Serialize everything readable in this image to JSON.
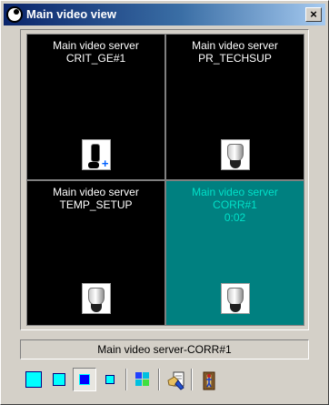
{
  "window": {
    "title": "Main video view",
    "close_glyph": "×",
    "app_icon": "camera-lens-icon"
  },
  "cells": [
    {
      "line1": "Main video server",
      "line2": "CRIT_GE#1",
      "line3": "",
      "camera_icon": "ptz-camera-icon",
      "active": false
    },
    {
      "line1": "Main video server",
      "line2": "PR_TECHSUP",
      "line3": "",
      "camera_icon": "dome-camera-icon",
      "active": false
    },
    {
      "line1": "Main video server",
      "line2": "TEMP_SETUP",
      "line3": "",
      "camera_icon": "dome-camera-icon",
      "active": false
    },
    {
      "line1": "Main video server",
      "line2": "CORR#1",
      "line3": "0:02",
      "camera_icon": "dome-camera-icon",
      "active": true
    }
  ],
  "status": {
    "text": "Main video server-CORR#1"
  },
  "toolbar": {
    "buttons": [
      {
        "name": "layout-1x1-button",
        "icon": "cyan-square-icon",
        "pressed": false
      },
      {
        "name": "layout-2x2-button",
        "icon": "cyan-square-icon",
        "pressed": false
      },
      {
        "name": "layout-3x3-button",
        "icon": "blue-square-icon",
        "pressed": true
      },
      {
        "name": "layout-4x4-button",
        "icon": "cyan-square-icon",
        "pressed": false
      },
      {
        "name": "layout-quad-button",
        "icon": "multicolor-grid-icon",
        "pressed": false
      },
      {
        "name": "properties-button",
        "icon": "hand-document-icon",
        "pressed": false
      },
      {
        "name": "exit-button",
        "icon": "door-exit-icon",
        "pressed": false
      }
    ]
  },
  "colors": {
    "titlebar_start": "#0a246a",
    "titlebar_end": "#a6caf0",
    "active_cell": "#008080",
    "active_text": "#00e0c8",
    "window_bg": "#d4d0c8"
  }
}
